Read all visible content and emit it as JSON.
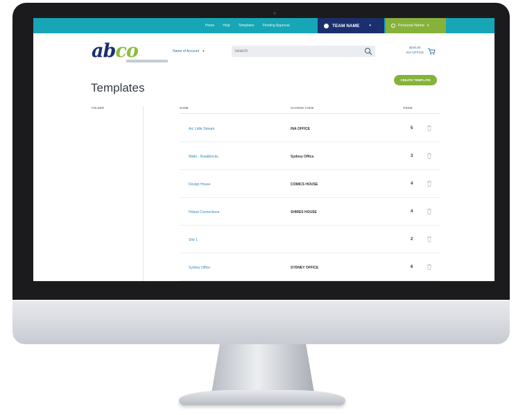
{
  "topnav": {
    "links": [
      "Home",
      "Help",
      "Templates",
      "Pending Approval"
    ],
    "team_name": "TEAM NAME",
    "personal_name": "Personal Name"
  },
  "brand": {
    "logo_part1": "ab",
    "logo_part2": "co"
  },
  "header": {
    "account_label": "Name of Account",
    "search_placeholder": "Search",
    "cart_line1": "$150.00",
    "cart_line2": "INA OFFICE"
  },
  "page": {
    "title": "Templates",
    "create_button": "CREATE TEMPLATE"
  },
  "table": {
    "left_column_header": "FOLDER",
    "headers": {
      "name": "NAME",
      "cost_centre": "CHARGE CODE",
      "items": "ITEMS"
    },
    "rows": [
      {
        "name": "Art, Little Stream",
        "cost_centre": "INA OFFICE",
        "items": "5"
      },
      {
        "name": "Walls - Roadblocks",
        "cost_centre": "Sydney Office",
        "items": "3"
      },
      {
        "name": "Design House",
        "cost_centre": "COMICS HOUSE",
        "items": "4"
      },
      {
        "name": "Hobart Connections",
        "cost_centre": "SHIRES HOUSE",
        "items": "4"
      },
      {
        "name": "Site 1",
        "cost_centre": "",
        "items": "2"
      },
      {
        "name": "Sydney Office",
        "cost_centre": "SYDNEY OFFICE",
        "items": "6"
      }
    ]
  },
  "colors": {
    "topbar": "#16a6b6",
    "team": "#1b2f6e",
    "accent_green": "#86b23c",
    "link_blue": "#2f86b8"
  }
}
